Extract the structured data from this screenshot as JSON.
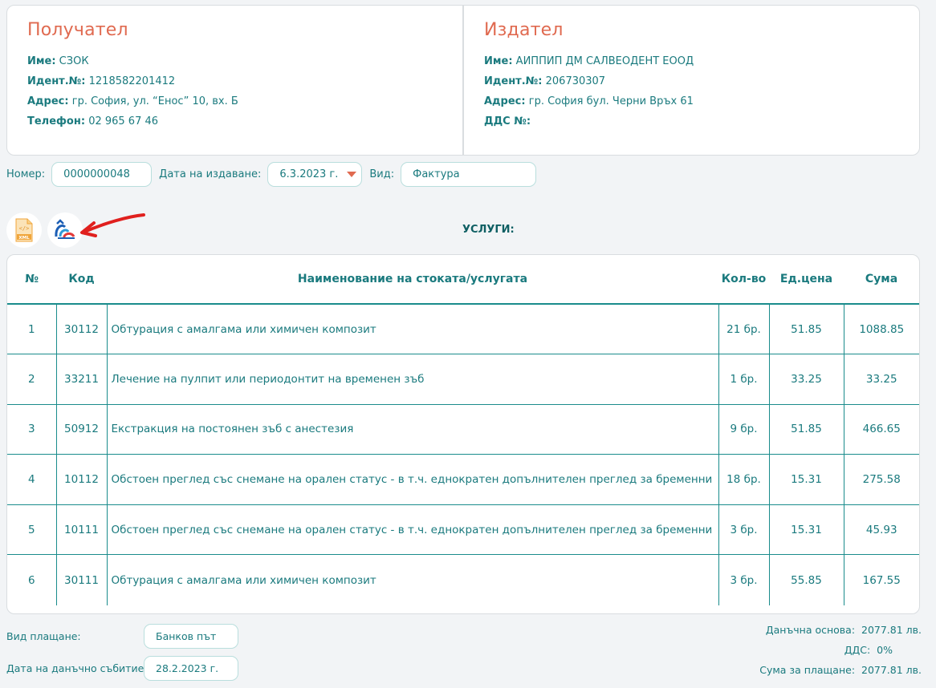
{
  "recipient": {
    "title": "Получател",
    "name_label": "Име:",
    "name": "СЗОК",
    "id_label": "Идент.№:",
    "id": "1218582201412",
    "address_label": "Адрес:",
    "address": "гр. София, ул. “Енос” 10, вх. Б",
    "phone_label": "Телефон:",
    "phone": "02 965 67 46"
  },
  "issuer": {
    "title": "Издател",
    "name_label": "Име:",
    "name": "АИППИП ДМ САЛВЕОДЕНТ ЕООД",
    "id_label": "Идент.№:",
    "id": "206730307",
    "address_label": "Адрес:",
    "address": "гр. София бул. Черни Връх 61",
    "vat_label": "ДДС №:",
    "vat": ""
  },
  "meta": {
    "number_label": "Номер:",
    "number": "0000000048",
    "issue_date_label": "Дата на издаване:",
    "issue_date": "6.3.2023 г.",
    "type_label": "Вид:",
    "type": "Фактура"
  },
  "icons": {
    "xml": "xml-file-icon",
    "nhif": "nhif-logo-icon",
    "arrow": "red-arrow-annotation"
  },
  "services": {
    "title": "УСЛУГИ:",
    "headers": [
      "№",
      "Код",
      "Наименование на стоката/услугата",
      "Кол-во",
      "Ед.цена",
      "Сума"
    ],
    "rows": [
      {
        "no": "1",
        "code": "30112",
        "name": "Обтурация с амалгама или химичен композит",
        "qty": "21 бр.",
        "price": "51.85",
        "sum": "1088.85"
      },
      {
        "no": "2",
        "code": "33211",
        "name": "Лечение на пулпит или периодонтит на временен зъб",
        "qty": "1 бр.",
        "price": "33.25",
        "sum": "33.25"
      },
      {
        "no": "3",
        "code": "50912",
        "name": "Екстракция на постоянен зъб с анестезия",
        "qty": "9 бр.",
        "price": "51.85",
        "sum": "466.65"
      },
      {
        "no": "4",
        "code": "10112",
        "name": "Обстоен преглед със снемане на орален статус - в т.ч. еднократен допълнителен преглед за бременни",
        "qty": "18 бр.",
        "price": "15.31",
        "sum": "275.58"
      },
      {
        "no": "5",
        "code": "10111",
        "name": "Обстоен преглед със снемане на орален статус - в т.ч. еднократен допълнителен преглед за бременни",
        "qty": "3 бр.",
        "price": "15.31",
        "sum": "45.93"
      },
      {
        "no": "6",
        "code": "30111",
        "name": "Обтурация с амалгама или химичен композит",
        "qty": "3 бр.",
        "price": "55.85",
        "sum": "167.55"
      }
    ]
  },
  "payment": {
    "method_label": "Вид плащане:",
    "method": "Банков път",
    "tax_date_label": "Дата на данъчно събитие:",
    "tax_date": "28.2.2023 г."
  },
  "totals": {
    "base_label": "Данъчна основа:",
    "base": "2077.81 лв.",
    "vat_label": "ДДС:",
    "vat": "0%",
    "due_label": "Сума за плащане:",
    "due": "2077.81 лв."
  }
}
